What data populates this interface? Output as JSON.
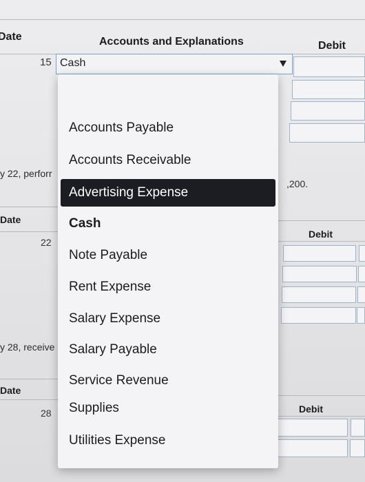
{
  "header": {
    "date_label": "Date",
    "accounts_label": "Accounts and Explanations",
    "debit_label": "Debit"
  },
  "entry1": {
    "day": "15",
    "account_select_value": "Cash"
  },
  "fragments": {
    "row22_text": "y 22, perforr",
    "amount_text": ",200.",
    "row28_text": "y 28, receive"
  },
  "section2": {
    "date_label": "Date",
    "day": "22",
    "debit_label": "Debit"
  },
  "section3": {
    "date_label": "Date",
    "day": "28",
    "debit_label": "Debit"
  },
  "dropdown": {
    "options": [
      "Accounts Payable",
      "Accounts Receivable",
      "Advertising Expense",
      "Cash",
      "Note Payable",
      "Rent Expense",
      "Salary Expense",
      "Salary Payable",
      "Service Revenue",
      "Supplies",
      "Utilities Expense"
    ],
    "highlighted": "Advertising Expense",
    "selected": "Cash"
  },
  "colors": {
    "highlight_bg": "#1b1d22",
    "select_border": "#7aa0cf",
    "debit_box_border": "#9fb4c8"
  },
  "icons": {
    "select_caret": "caret-down-icon"
  }
}
